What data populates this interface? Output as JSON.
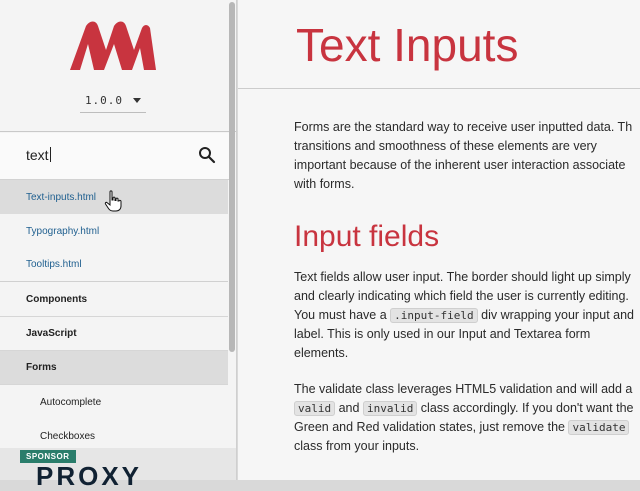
{
  "sidebar": {
    "version": "1.0.0",
    "search_value": "text",
    "results": [
      "Text-inputs.html",
      "Typography.html",
      "Tooltips.html"
    ],
    "sections": [
      "Components",
      "JavaScript",
      "Forms"
    ],
    "subitems": [
      "Autocomplete",
      "Checkboxes"
    ],
    "sponsor_label": "SPONSOR",
    "sponsor_text": "PROXY"
  },
  "main": {
    "title": "Text Inputs",
    "intro": [
      "Forms are the standard way to receive user inputted data. Th",
      "transitions and smoothness of these elements are very",
      "important because of the inherent user interaction associate",
      "with forms."
    ],
    "section_title": "Input fields",
    "p1": {
      "line1": "Text fields allow user input. The border should light up simply",
      "line2": "and clearly indicating which field the user is currently editing.",
      "line3_pre": "You must have a",
      "code1": ".input-field",
      "line3_post": "div wrapping your input and",
      "line4": "label. This is only used in our Input and Textarea form",
      "line5": "elements."
    },
    "p2": {
      "line1": "The validate class leverages HTML5 validation and will add a",
      "code_valid": "valid",
      "and": "and",
      "code_invalid": "invalid",
      "line2_post": "class accordingly. If you don't want the",
      "line3_pre": "Green and Red validation states, just remove the",
      "code_validate": "validate",
      "line4": "class from your inputs."
    }
  },
  "colors": {
    "accent": "#c8343f",
    "link": "#1f5f8f"
  }
}
